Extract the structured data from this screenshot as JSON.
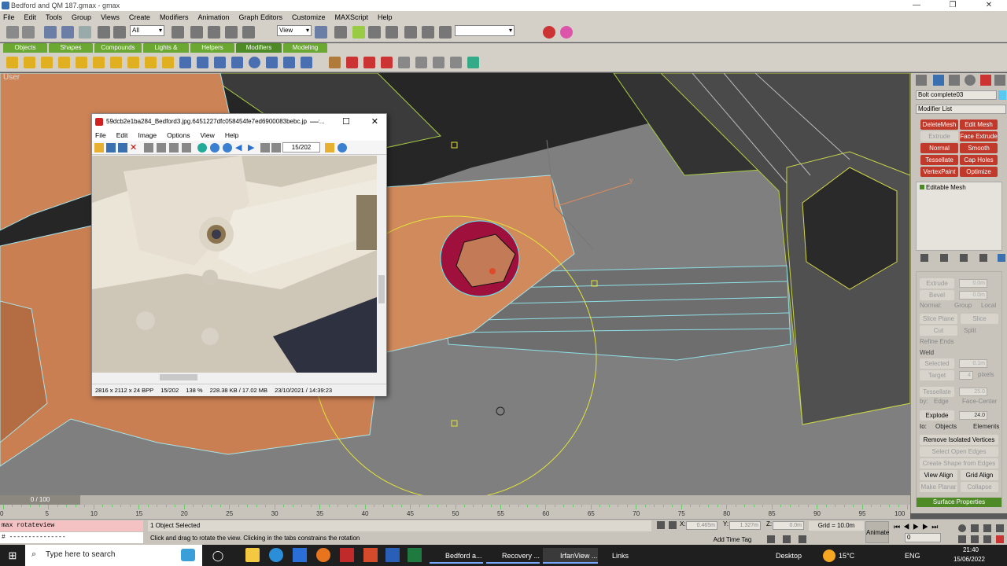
{
  "window": {
    "title": "Bedford and QM 187.gmax - gmax"
  },
  "menu": [
    "File",
    "Edit",
    "Tools",
    "Group",
    "Views",
    "Create",
    "Modifiers",
    "Animation",
    "Graph Editors",
    "Customize",
    "MAXScript",
    "Help"
  ],
  "toolbar": {
    "selection_filter": "All",
    "ref_coord": "View"
  },
  "tabs": [
    "Objects",
    "Shapes",
    "Compounds",
    "Lights & Cameras",
    "Helpers",
    "Modifiers",
    "Modeling"
  ],
  "viewport": {
    "label": "User",
    "gizmo_axis": "y"
  },
  "command_panel": {
    "object_name": "Bolt complete03",
    "modifier_list": "Modifier List",
    "buttons": [
      {
        "label": "DeleteMesh",
        "state": "active"
      },
      {
        "label": "Edit Mesh",
        "state": "active"
      },
      {
        "label": "Extrude",
        "state": "disabled"
      },
      {
        "label": "Face Extrude",
        "state": "active"
      },
      {
        "label": "Normal",
        "state": "active"
      },
      {
        "label": "Smooth",
        "state": "active"
      },
      {
        "label": "Tessellate",
        "state": "active"
      },
      {
        "label": "Cap Holes",
        "state": "active"
      },
      {
        "label": "VertexPaint",
        "state": "active"
      },
      {
        "label": "Optimize",
        "state": "active"
      }
    ],
    "stack_item": "Editable Mesh",
    "extrude_label": "Extrude",
    "extrude_value": "0.0m",
    "bevel_label": "Bevel",
    "bevel_value": "0.0m",
    "normal_label": "Normal:",
    "group_label": "Group",
    "local_label": "Local",
    "slice_plane": "Slice Plane",
    "slice": "Slice",
    "cut": "Cut",
    "split": "Split",
    "refine_ends": "Refine Ends",
    "weld_title": "Weld",
    "selected_label": "Selected",
    "selected_value": "0.1m",
    "target_label": "Target",
    "target_value": "4",
    "pixels_label": "pixels",
    "tessellate_label": "Tessellate",
    "tessellate_value": "25.0",
    "by_label": "by:",
    "edge_label": "Edge",
    "face_center_label": "Face-Center",
    "explode_label": "Explode",
    "explode_value": "24.0",
    "to_label": "to:",
    "objects_label": "Objects",
    "elements_label": "Elements",
    "remove_isolated": "Remove Isolated Vertices",
    "select_open_edges": "Select Open Edges",
    "create_shape": "Create Shape from Edges",
    "view_align": "View Align",
    "grid_align": "Grid Align",
    "make_planar": "Make Planar",
    "collapse": "Collapse",
    "surface_properties": "Surface Properties"
  },
  "irfanview": {
    "title": "59dcb2e1ba284_Bedford3.jpg.6451227dfc058454fe7ed6900083bebc.jpg - Ir...",
    "menu": [
      "File",
      "Edit",
      "Image",
      "Options",
      "View",
      "Help"
    ],
    "page": "15/202",
    "status": [
      "2816 x 2112 x 24 BPP",
      "15/202",
      "138 %",
      "228.38 KB / 17.02 MB",
      "23/10/2021 / 14:39:23"
    ]
  },
  "timeline": {
    "frame": "0 / 100",
    "ticks": [
      "0",
      "5",
      "10",
      "15",
      "20",
      "25",
      "30",
      "35",
      "40",
      "45",
      "50",
      "55",
      "60",
      "65",
      "70",
      "75",
      "80",
      "85",
      "90",
      "95",
      "100"
    ]
  },
  "status": {
    "maxscript_line1": "max rotateview",
    "maxscript_line2": "# ---------------",
    "selected": "1 Object Selected",
    "prompt": "Click and drag to rotate the view.  Clicking in the tabs constrains the rotation",
    "x_label": "X:",
    "x_value": "0.465m",
    "y_label": "Y:",
    "y_value": "1.327m",
    "z_label": "Z:",
    "z_value": "0.0m",
    "grid": "Grid = 10.0m",
    "add_time_tag": "Add Time Tag",
    "animate": "Animate",
    "frame_field": "0"
  },
  "taskbar": {
    "search_placeholder": "Type here to search",
    "apps": [
      {
        "label": "Bedford a..."
      },
      {
        "label": "Recovery ..."
      },
      {
        "label": "IrfanView ..."
      },
      {
        "label": "Links"
      }
    ],
    "desktop": "Desktop",
    "temperature": "15°C",
    "language": "ENG",
    "time": "21:40",
    "date": "15/06/2022"
  }
}
